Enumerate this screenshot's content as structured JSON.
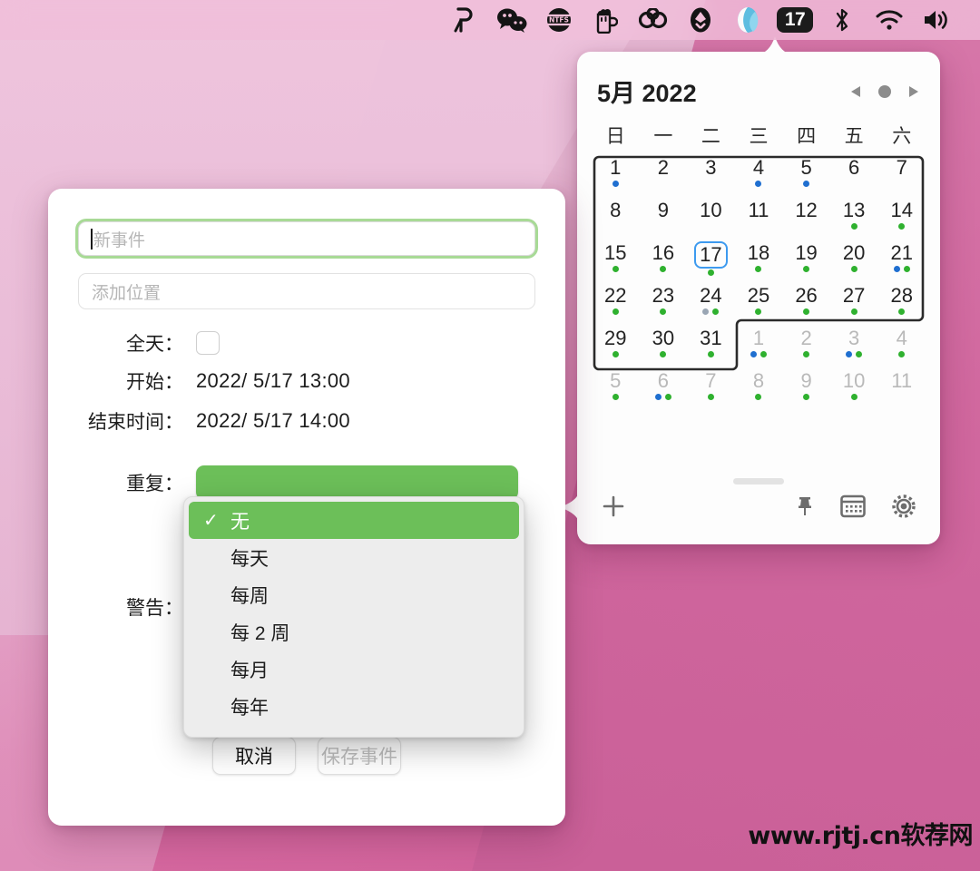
{
  "menubar": {
    "items": [
      {
        "name": "pixelmator-icon",
        "label": "P"
      },
      {
        "name": "wechat-icon",
        "label": "WeChat"
      },
      {
        "name": "ntfs-icon",
        "label": "NTFS"
      },
      {
        "name": "beer-icon",
        "label": "Beer"
      },
      {
        "name": "cloud-icon",
        "label": "Cloud"
      },
      {
        "name": "flower-icon",
        "label": "Flower"
      },
      {
        "name": "wave-icon",
        "label": "Wave"
      },
      {
        "name": "date-badge",
        "label": "17"
      },
      {
        "name": "bluetooth-icon",
        "label": "Bluetooth"
      },
      {
        "name": "wifi-icon",
        "label": "Wi-Fi"
      },
      {
        "name": "volume-icon",
        "label": "Volume"
      }
    ]
  },
  "calendar": {
    "title": "5月 2022",
    "nav": {
      "prev": "◀",
      "today": "●",
      "next": "▶"
    },
    "weekdays": [
      "日",
      "一",
      "二",
      "三",
      "四",
      "五",
      "六"
    ],
    "weeks": [
      [
        {
          "n": "1",
          "cur": true,
          "dots": [
            "b"
          ]
        },
        {
          "n": "2",
          "cur": true,
          "dots": []
        },
        {
          "n": "3",
          "cur": true,
          "dots": []
        },
        {
          "n": "4",
          "cur": true,
          "dots": [
            "b"
          ]
        },
        {
          "n": "5",
          "cur": true,
          "dots": [
            "b"
          ]
        },
        {
          "n": "6",
          "cur": true,
          "dots": []
        },
        {
          "n": "7",
          "cur": true,
          "dots": []
        }
      ],
      [
        {
          "n": "8",
          "cur": true,
          "dots": []
        },
        {
          "n": "9",
          "cur": true,
          "dots": []
        },
        {
          "n": "10",
          "cur": true,
          "dots": []
        },
        {
          "n": "11",
          "cur": true,
          "dots": []
        },
        {
          "n": "12",
          "cur": true,
          "dots": []
        },
        {
          "n": "13",
          "cur": true,
          "dots": [
            "g"
          ]
        },
        {
          "n": "14",
          "cur": true,
          "dots": [
            "g"
          ]
        }
      ],
      [
        {
          "n": "15",
          "cur": true,
          "dots": [
            "g"
          ]
        },
        {
          "n": "16",
          "cur": true,
          "dots": [
            "g"
          ]
        },
        {
          "n": "17",
          "cur": true,
          "dots": [
            "g"
          ],
          "today": true
        },
        {
          "n": "18",
          "cur": true,
          "dots": [
            "g"
          ]
        },
        {
          "n": "19",
          "cur": true,
          "dots": [
            "g"
          ]
        },
        {
          "n": "20",
          "cur": true,
          "dots": [
            "g"
          ]
        },
        {
          "n": "21",
          "cur": true,
          "dots": [
            "b",
            "g"
          ]
        }
      ],
      [
        {
          "n": "22",
          "cur": true,
          "dots": [
            "g"
          ]
        },
        {
          "n": "23",
          "cur": true,
          "dots": [
            "g"
          ]
        },
        {
          "n": "24",
          "cur": true,
          "dots": [
            "y",
            "g"
          ]
        },
        {
          "n": "25",
          "cur": true,
          "dots": [
            "g"
          ]
        },
        {
          "n": "26",
          "cur": true,
          "dots": [
            "g"
          ]
        },
        {
          "n": "27",
          "cur": true,
          "dots": [
            "g"
          ]
        },
        {
          "n": "28",
          "cur": true,
          "dots": [
            "g"
          ]
        }
      ],
      [
        {
          "n": "29",
          "cur": true,
          "dots": [
            "g"
          ]
        },
        {
          "n": "30",
          "cur": true,
          "dots": [
            "g"
          ]
        },
        {
          "n": "31",
          "cur": true,
          "dots": [
            "g"
          ]
        },
        {
          "n": "1",
          "cur": false,
          "dots": [
            "b",
            "g"
          ]
        },
        {
          "n": "2",
          "cur": false,
          "dots": [
            "g"
          ]
        },
        {
          "n": "3",
          "cur": false,
          "dots": [
            "b",
            "g"
          ]
        },
        {
          "n": "4",
          "cur": false,
          "dots": [
            "g"
          ]
        }
      ],
      [
        {
          "n": "5",
          "cur": false,
          "dots": [
            "g"
          ]
        },
        {
          "n": "6",
          "cur": false,
          "dots": [
            "b",
            "g"
          ]
        },
        {
          "n": "7",
          "cur": false,
          "dots": [
            "g"
          ]
        },
        {
          "n": "8",
          "cur": false,
          "dots": [
            "g"
          ]
        },
        {
          "n": "9",
          "cur": false,
          "dots": [
            "g"
          ]
        },
        {
          "n": "10",
          "cur": false,
          "dots": [
            "g"
          ]
        },
        {
          "n": "11",
          "cur": false,
          "dots": []
        }
      ]
    ],
    "footer": {
      "add": "+",
      "pin": "pin-icon",
      "calendar": "calendar-icon",
      "settings": "gear-icon"
    },
    "colors": {
      "today_ring": "#3d9aef",
      "dot_green": "#2fb12f",
      "dot_blue": "#1f6fd0",
      "dot_gray": "#9aa6b4"
    }
  },
  "dialog": {
    "title_placeholder": "新事件",
    "location_placeholder": "添加位置",
    "allday_label": "全天：",
    "start_label": "开始：",
    "start_value": "2022/  5/17 13:00",
    "end_label": "结束时间：",
    "end_value": "2022/  5/17 14:00",
    "repeat_label": "重复：",
    "alert_label": "警告：",
    "cancel_button": "取消",
    "save_button": "保存事件",
    "accent_green": "#6cbf59"
  },
  "repeat_menu": {
    "options": [
      {
        "label": "无",
        "selected": true
      },
      {
        "label": "每天",
        "selected": false
      },
      {
        "label": "每周",
        "selected": false
      },
      {
        "label": "每 2 周",
        "selected": false
      },
      {
        "label": "每月",
        "selected": false
      },
      {
        "label": "每年",
        "selected": false
      }
    ],
    "check": "✓"
  },
  "watermark": {
    "text": "www.rjtj.cn软荐网"
  }
}
